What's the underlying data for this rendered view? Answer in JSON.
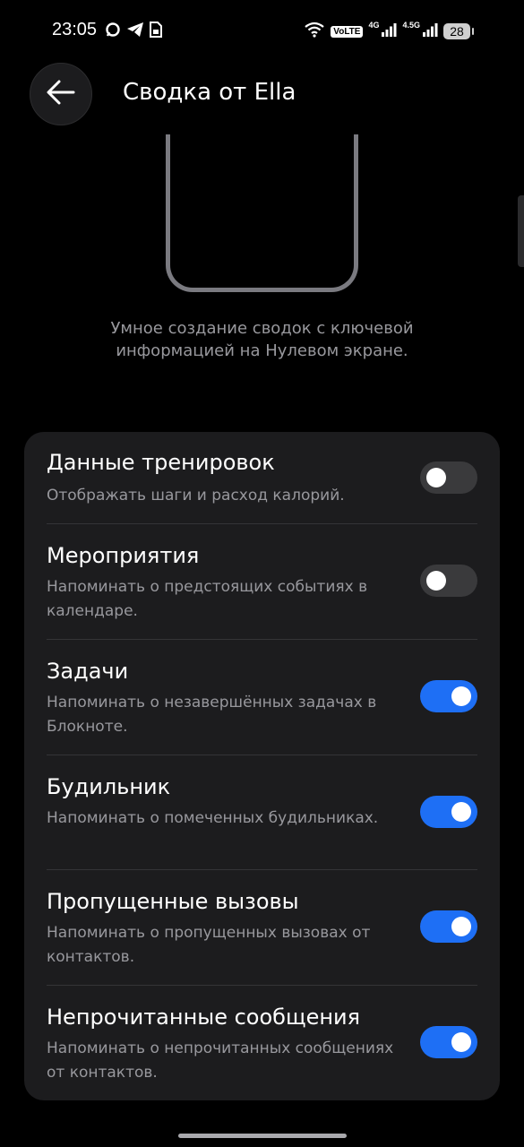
{
  "status_bar": {
    "time": "23:05",
    "volte": "VoLTE",
    "sim1_network": "4G",
    "sim2_network": "4.5G",
    "battery": "28",
    "icons": [
      "chat-bubble-icon",
      "telegram-icon",
      "sim-card-icon",
      "wifi-icon",
      "signal-icon",
      "battery-icon"
    ]
  },
  "header": {
    "title": "Сводка от Ella",
    "back_icon": "arrow-left-icon"
  },
  "description": "Умное создание сводок с ключевой информацией на Нулевом экране.",
  "colors": {
    "background": "#000000",
    "card": "#1c1c1e",
    "accent": "#1e6ff5",
    "secondary_text": "#98989d"
  },
  "settings": [
    {
      "title": "Данные тренировок",
      "description": "Отображать шаги и расход калорий.",
      "enabled": false
    },
    {
      "title": "Мероприятия",
      "description": "Напоминать о предстоящих событиях в календаре.",
      "enabled": false
    },
    {
      "title": "Задачи",
      "description": "Напоминать о незавершённых задачах в Блокноте.",
      "enabled": true
    },
    {
      "title": "Будильник",
      "description": "Напоминать о помеченных будильниках.",
      "enabled": true
    },
    {
      "title": "Пропущенные вызовы",
      "description": "Напоминать о пропущенных вызовах от контактов.",
      "enabled": true
    },
    {
      "title": "Непрочитанные сообщения",
      "description": "Напоминать о непрочитанных сообщениях от контактов.",
      "enabled": true
    }
  ]
}
